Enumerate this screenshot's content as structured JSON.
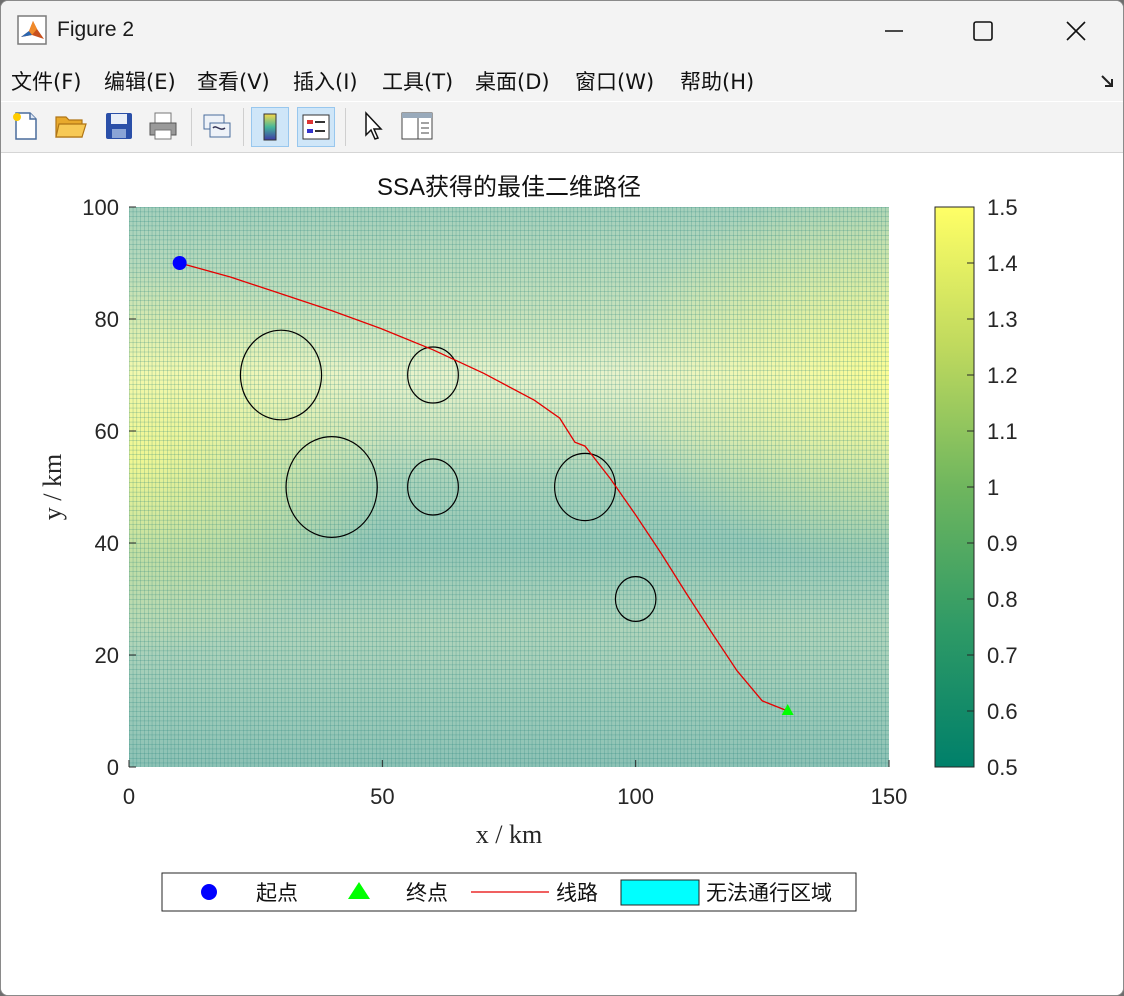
{
  "window": {
    "title": "Figure 2"
  },
  "menu": [
    "文件(F)",
    "编辑(E)",
    "查看(V)",
    "插入(I)",
    "工具(T)",
    "桌面(D)",
    "窗口(W)",
    "帮助(H)"
  ],
  "toolbar": [
    "new-figure-icon",
    "open-file-icon",
    "save-icon",
    "print-icon",
    "link-plot-icon",
    "insert-colorbar-icon",
    "insert-legend-icon",
    "edit-plot-pointer-icon",
    "property-editor-icon"
  ],
  "colors": {
    "path": "#e60000",
    "start": "#0000ff",
    "end": "#00ff00",
    "no_go": "#00ffff",
    "obstacle": "#000000",
    "cmap_low": "#00806a",
    "cmap_high": "#ffff66"
  },
  "chart_data": {
    "type": "line",
    "title": "SSA获得的最佳二维路径",
    "xlabel": "x / km",
    "ylabel": "y / km",
    "xlim": [
      0,
      150
    ],
    "ylim": [
      0,
      100
    ],
    "xticks": [
      "0",
      "50",
      "100",
      "150"
    ],
    "yticks": [
      "0",
      "20",
      "40",
      "60",
      "80",
      "100"
    ],
    "grid_mesh": true,
    "start": {
      "x": 10,
      "y": 90
    },
    "end": {
      "x": 130,
      "y": 10
    },
    "path": [
      [
        10,
        90
      ],
      [
        20,
        87.5
      ],
      [
        30,
        84.5
      ],
      [
        40,
        81.5
      ],
      [
        50,
        78.2
      ],
      [
        60,
        74.5
      ],
      [
        70,
        70.3
      ],
      [
        80,
        65.5
      ],
      [
        85,
        62.3
      ],
      [
        88,
        58
      ],
      [
        90,
        57.3
      ],
      [
        95,
        51.5
      ],
      [
        100,
        45
      ],
      [
        105,
        38.2
      ],
      [
        110,
        31
      ],
      [
        115,
        24
      ],
      [
        120,
        17.2
      ],
      [
        125,
        11.8
      ],
      [
        130,
        10
      ]
    ],
    "obstacles": [
      {
        "x": 30,
        "y": 70,
        "r": 8
      },
      {
        "x": 60,
        "y": 70,
        "r": 5
      },
      {
        "x": 40,
        "y": 50,
        "r": 9
      },
      {
        "x": 60,
        "y": 50,
        "r": 5
      },
      {
        "x": 90,
        "y": 50,
        "r": 6
      },
      {
        "x": 100,
        "y": 30,
        "r": 4
      }
    ],
    "colorbar": {
      "min": 0.5,
      "max": 1.5,
      "ticks": [
        "0.5",
        "0.6",
        "0.7",
        "0.8",
        "0.9",
        "1",
        "1.1",
        "1.2",
        "1.3",
        "1.4",
        "1.5"
      ]
    },
    "legend": [
      "起点",
      "终点",
      "线路",
      "无法通行区域"
    ],
    "legend_position": "bottom"
  }
}
